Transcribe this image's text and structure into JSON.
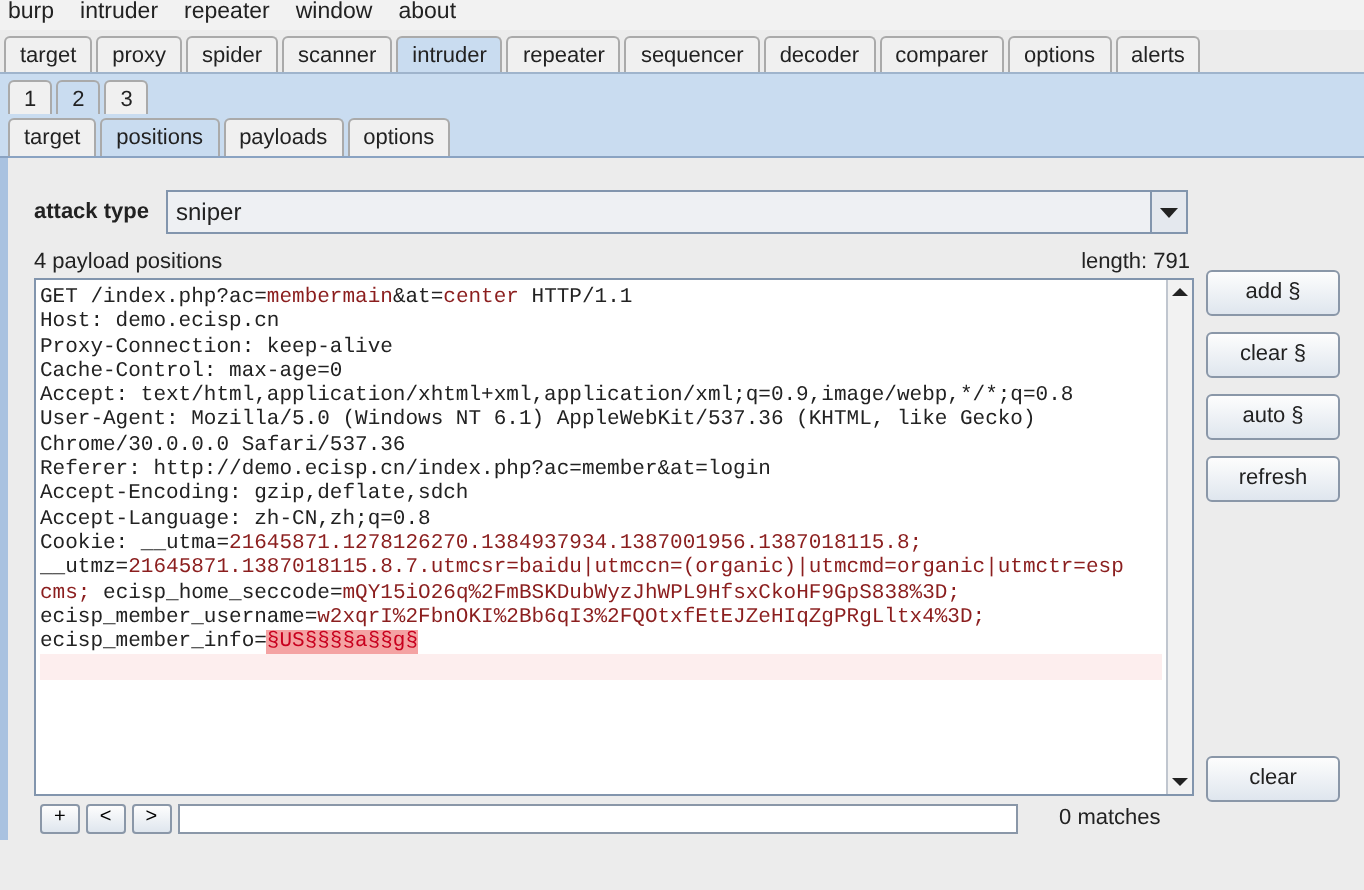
{
  "menu": [
    "burp",
    "intruder",
    "repeater",
    "window",
    "about"
  ],
  "tabs": [
    {
      "label": "target",
      "selected": false
    },
    {
      "label": "proxy",
      "selected": false
    },
    {
      "label": "spider",
      "selected": false
    },
    {
      "label": "scanner",
      "selected": false
    },
    {
      "label": "intruder",
      "selected": true
    },
    {
      "label": "repeater",
      "selected": false
    },
    {
      "label": "sequencer",
      "selected": false
    },
    {
      "label": "decoder",
      "selected": false
    },
    {
      "label": "comparer",
      "selected": false
    },
    {
      "label": "options",
      "selected": false
    },
    {
      "label": "alerts",
      "selected": false
    }
  ],
  "instance_tabs": [
    {
      "label": "1",
      "selected": false
    },
    {
      "label": "2",
      "selected": true
    },
    {
      "label": "3",
      "selected": false
    }
  ],
  "sub_tabs": [
    {
      "label": "target",
      "selected": false
    },
    {
      "label": "positions",
      "selected": true
    },
    {
      "label": "payloads",
      "selected": false
    },
    {
      "label": "options",
      "selected": false
    }
  ],
  "attack_type": {
    "label": "attack type",
    "value": "sniper"
  },
  "positions_count": "4 payload positions",
  "length": "length: 791",
  "request_lines": [
    {
      "segments": [
        {
          "kind": "plain",
          "text": "GET /index.php?ac="
        },
        {
          "kind": "param",
          "text": "membermain"
        },
        {
          "kind": "plain",
          "text": "&at="
        },
        {
          "kind": "param",
          "text": "center"
        },
        {
          "kind": "plain",
          "text": " HTTP/1.1"
        }
      ]
    },
    {
      "segments": [
        {
          "kind": "plain",
          "text": "Host: demo.ecisp.cn"
        }
      ]
    },
    {
      "segments": [
        {
          "kind": "plain",
          "text": "Proxy-Connection: keep-alive"
        }
      ]
    },
    {
      "segments": [
        {
          "kind": "plain",
          "text": "Cache-Control: max-age=0"
        }
      ]
    },
    {
      "segments": [
        {
          "kind": "plain",
          "text": "Accept: text/html,application/xhtml+xml,application/xml;q=0.9,image/webp,*/*;q=0.8"
        }
      ]
    },
    {
      "segments": [
        {
          "kind": "plain",
          "text": "User-Agent: Mozilla/5.0 (Windows NT 6.1) AppleWebKit/537.36 (KHTML, like Gecko)"
        }
      ]
    },
    {
      "segments": [
        {
          "kind": "plain",
          "text": "Chrome/30.0.0.0 Safari/537.36"
        }
      ]
    },
    {
      "segments": [
        {
          "kind": "plain",
          "text": "Referer: http://demo.ecisp.cn/index.php?ac=member&at=login"
        }
      ]
    },
    {
      "segments": [
        {
          "kind": "plain",
          "text": "Accept-Encoding: gzip,deflate,sdch"
        }
      ]
    },
    {
      "segments": [
        {
          "kind": "plain",
          "text": "Accept-Language: zh-CN,zh;q=0.8"
        }
      ]
    },
    {
      "segments": [
        {
          "kind": "plain",
          "text": "Cookie: __utma="
        },
        {
          "kind": "param",
          "text": "21645871.1278126270.1384937934.1387001956.1387018115.8;"
        }
      ]
    },
    {
      "segments": [
        {
          "kind": "plain",
          "text": "__utmz="
        },
        {
          "kind": "param",
          "text": "21645871.1387018115.8.7.utmcsr=baidu|utmccn=(organic)|utmcmd=organic|utmctr=esp"
        }
      ]
    },
    {
      "segments": [
        {
          "kind": "param",
          "text": "cms;"
        },
        {
          "kind": "plain",
          "text": " ecisp_home_seccode="
        },
        {
          "kind": "param",
          "text": "mQY15iO26q%2FmBSKDubWyzJhWPL9HfsxCkoHF9GpS838%3D;"
        }
      ]
    },
    {
      "segments": [
        {
          "kind": "plain",
          "text": "ecisp_member_username="
        },
        {
          "kind": "param",
          "text": "w2xqrI%2FbnOKI%2Bb6qI3%2FQOtxfEtEJZeHIqZgPRgLltx4%3D;"
        }
      ]
    },
    {
      "segments": [
        {
          "kind": "plain",
          "text": "ecisp_member_info="
        },
        {
          "kind": "payload",
          "text": "§US§§§§a§§g§"
        }
      ]
    }
  ],
  "side_buttons": [
    "add §",
    "clear §",
    "auto §",
    "refresh"
  ],
  "clear_button": "clear",
  "search_bar": {
    "buttons": [
      "+",
      "<",
      ">"
    ],
    "matches": "0 matches"
  }
}
